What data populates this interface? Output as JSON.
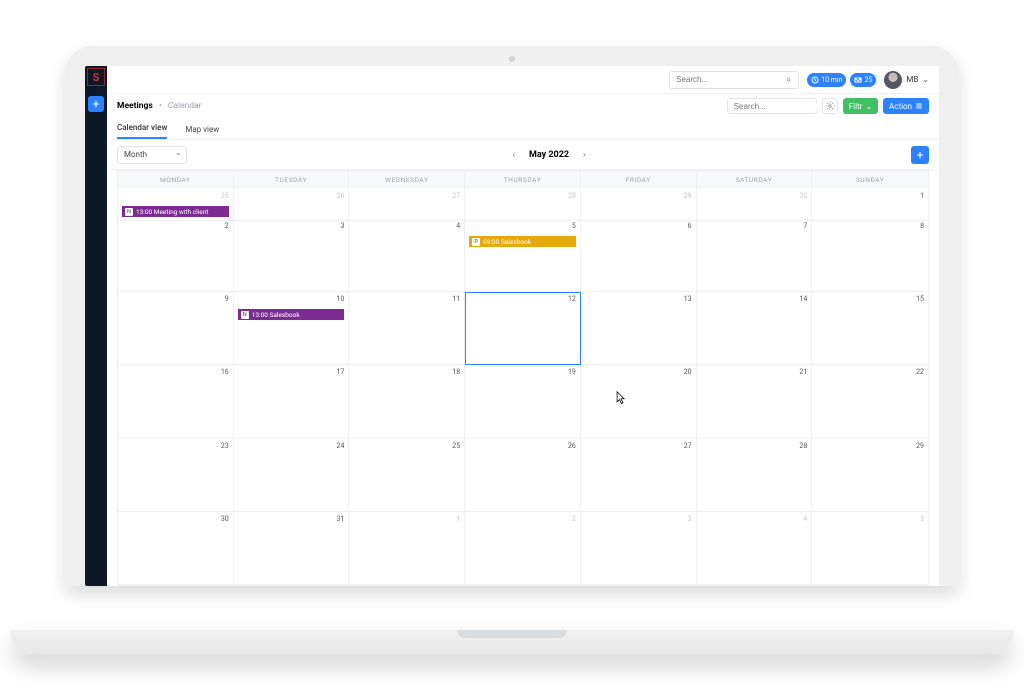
{
  "header": {
    "search_placeholder": "Search...",
    "notification_min_label": "10 min",
    "notification_count": "25",
    "user_initials": "MB"
  },
  "breadcrumb": {
    "page": "Meetings",
    "sub": "Calendar"
  },
  "subbar": {
    "search_placeholder": "Search...",
    "filter_label": "Filtr",
    "action_label": "Action"
  },
  "tabs": {
    "calendar": "Calendar view",
    "map": "Map view"
  },
  "controls": {
    "period": "Month",
    "current": "May 2022"
  },
  "days": [
    "MONDAY",
    "TUESDAY",
    "WEDNESDAY",
    "THURSDAY",
    "FRIDAY",
    "SATURDAY",
    "SUNDAY"
  ],
  "grid": [
    [
      {
        "n": "25",
        "dim": true,
        "events": [
          {
            "tag": "N",
            "text": "13:00 Meeting with client",
            "color": "purple"
          }
        ]
      },
      {
        "n": "26",
        "dim": true
      },
      {
        "n": "27",
        "dim": true
      },
      {
        "n": "28",
        "dim": true
      },
      {
        "n": "29",
        "dim": true
      },
      {
        "n": "30",
        "dim": true
      },
      {
        "n": "1"
      }
    ],
    [
      {
        "n": "2"
      },
      {
        "n": "3"
      },
      {
        "n": "4"
      },
      {
        "n": "5",
        "events": [
          {
            "tag": "P",
            "text": "09:00 Salesbook",
            "color": "amber"
          }
        ]
      },
      {
        "n": "6"
      },
      {
        "n": "7"
      },
      {
        "n": "8"
      }
    ],
    [
      {
        "n": "9"
      },
      {
        "n": "10",
        "events": [
          {
            "tag": "N",
            "text": "13:00 Salesbook",
            "color": "purple"
          }
        ]
      },
      {
        "n": "11"
      },
      {
        "n": "12",
        "selected": true
      },
      {
        "n": "13"
      },
      {
        "n": "14"
      },
      {
        "n": "15"
      }
    ],
    [
      {
        "n": "16"
      },
      {
        "n": "17"
      },
      {
        "n": "18"
      },
      {
        "n": "19"
      },
      {
        "n": "20"
      },
      {
        "n": "21"
      },
      {
        "n": "22"
      }
    ],
    [
      {
        "n": "23"
      },
      {
        "n": "24"
      },
      {
        "n": "25"
      },
      {
        "n": "26"
      },
      {
        "n": "27"
      },
      {
        "n": "28"
      },
      {
        "n": "29"
      }
    ],
    [
      {
        "n": "30"
      },
      {
        "n": "31"
      },
      {
        "n": "1",
        "dim": true
      },
      {
        "n": "2",
        "dim": true
      },
      {
        "n": "3",
        "dim": true
      },
      {
        "n": "4",
        "dim": true
      },
      {
        "n": "5",
        "dim": true
      }
    ]
  ]
}
